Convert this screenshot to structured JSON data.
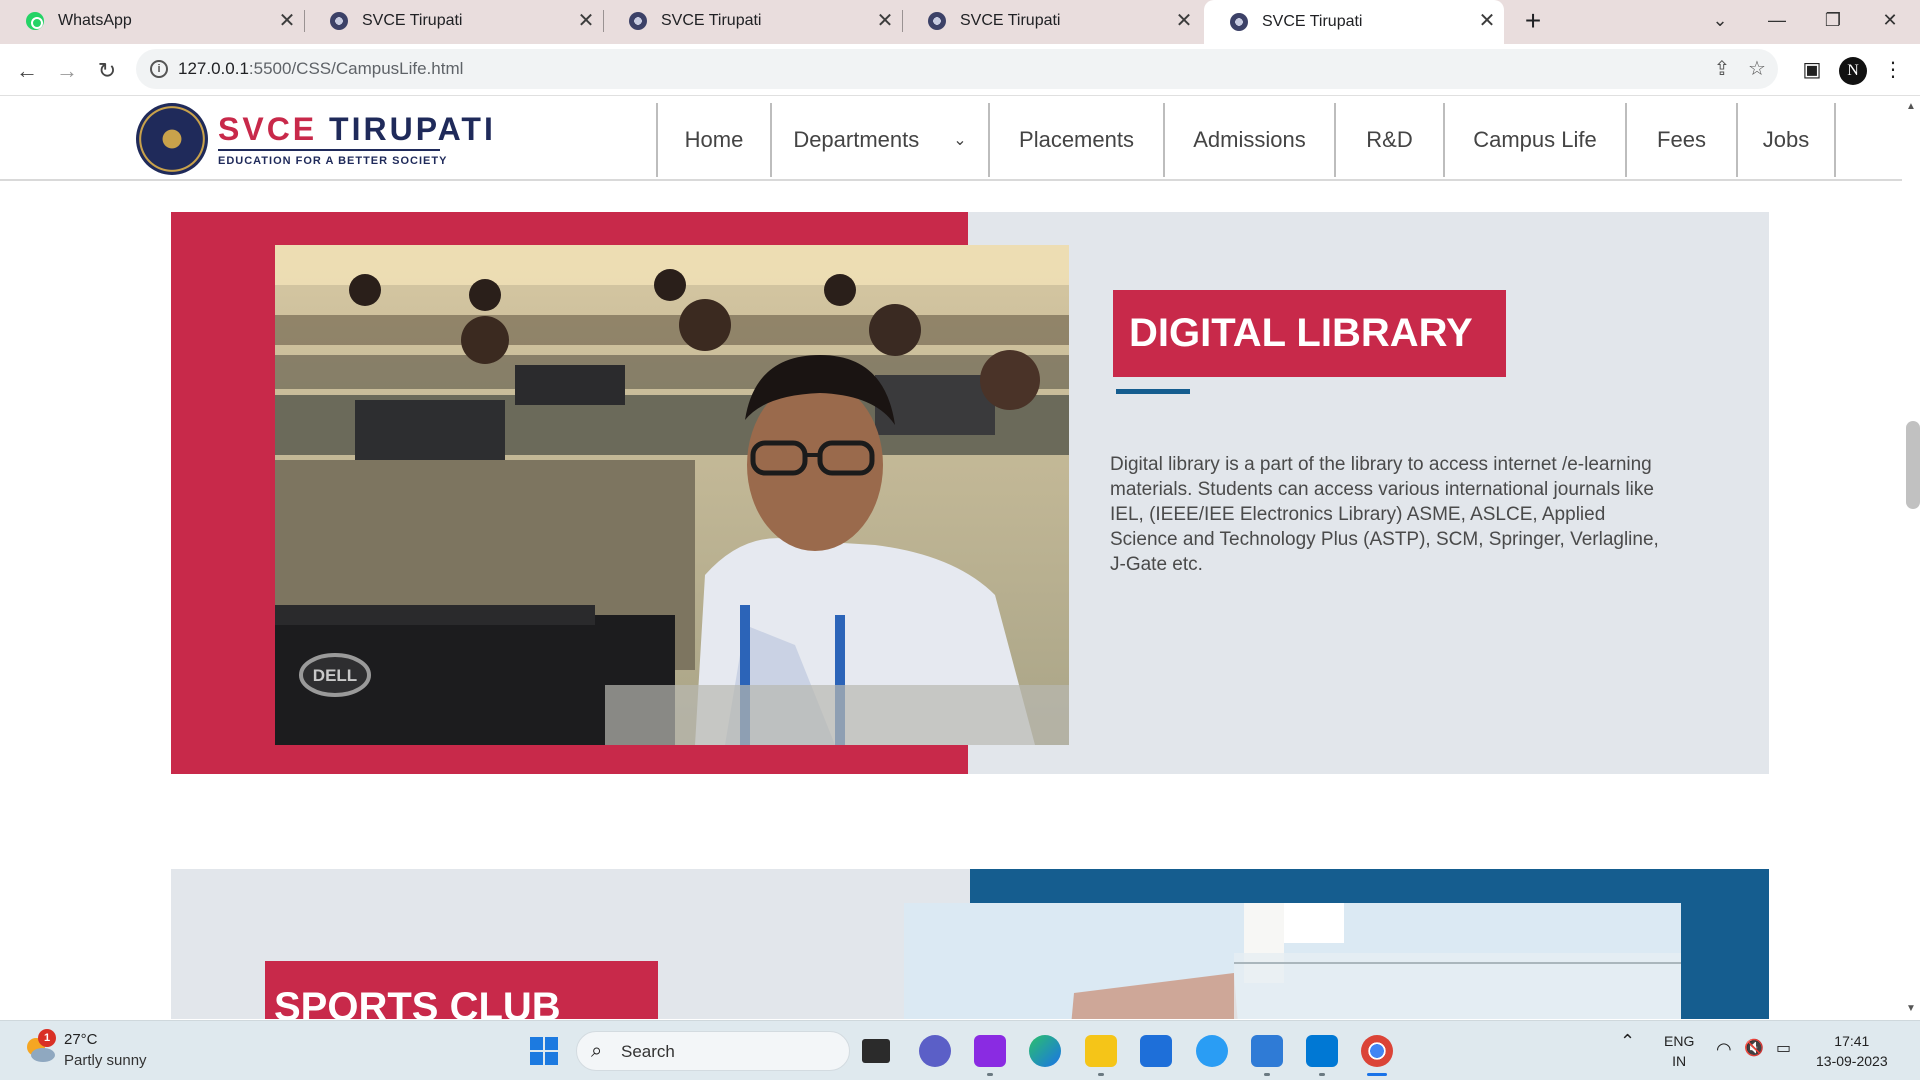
{
  "browser": {
    "tabs": [
      {
        "title": "WhatsApp",
        "favicon": "whatsapp-icon"
      },
      {
        "title": "SVCE Tirupati",
        "favicon": "svce-icon"
      },
      {
        "title": "SVCE Tirupati",
        "favicon": "svce-icon"
      },
      {
        "title": "SVCE Tirupati",
        "favicon": "svce-icon"
      },
      {
        "title": "SVCE Tirupati",
        "favicon": "svce-icon",
        "active": true
      }
    ],
    "url_host": "127.0.0.1",
    "url_path": ":5500/CSS/CampusLife.html",
    "profile_initial": "N"
  },
  "site": {
    "logo_title_red": "SVCE",
    "logo_title_blue": "TIRUPATI",
    "logo_tagline": "EDUCATION FOR A BETTER SOCIETY",
    "nav": [
      "Home",
      "Departments",
      "Placements",
      "Admissions",
      "R&D",
      "Campus Life",
      "Fees",
      "Jobs"
    ]
  },
  "digital_library": {
    "title": "DIGITAL LIBRARY",
    "description": "Digital library is a part of the library to access internet /e-learning materials. Students can access various international journals like IEL, (IEEE/IEE Electronics Library) ASME, ASLCE, Applied Science and Technology Plus (ASTP), SCM, Springer, Verlagline, J-Gate etc.",
    "photo_monitor_brand": "DELL"
  },
  "sports_club": {
    "title": "SPORTS CLUB"
  },
  "taskbar": {
    "weather_badge": "1",
    "weather_temp": "27°C",
    "weather_desc": "Partly sunny",
    "search_label": "Search",
    "lang_line1": "ENG",
    "lang_line2": "IN",
    "time": "17:41",
    "date": "13-09-2023"
  },
  "colors": {
    "brand_red": "#c8294a",
    "brand_blue": "#155d8f",
    "section_gray": "#e2e6eb"
  }
}
